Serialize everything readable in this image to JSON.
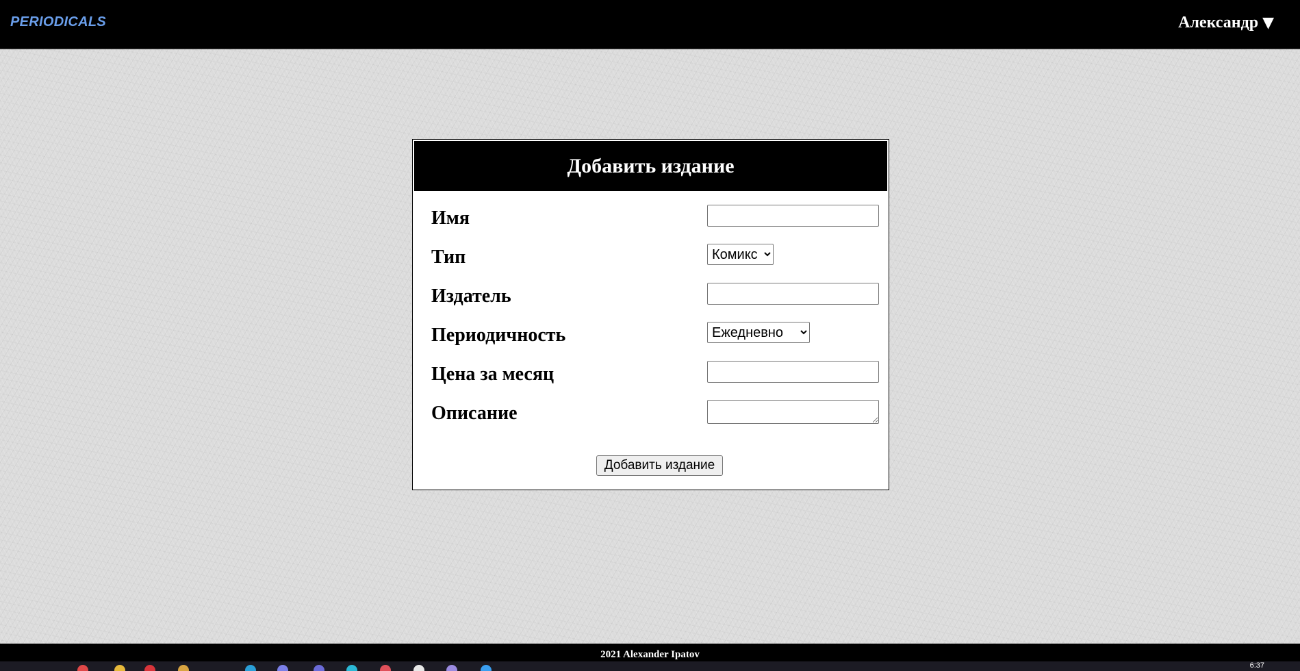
{
  "header": {
    "logo": "PERIODICALS",
    "user_name": "Александр",
    "user_caret": "▼"
  },
  "form": {
    "title": "Добавить издание",
    "fields": {
      "name": {
        "label": "Имя",
        "value": ""
      },
      "type": {
        "label": "Тип",
        "selected": "Комикс"
      },
      "publisher": {
        "label": "Издатель",
        "value": ""
      },
      "periodicity": {
        "label": "Периодичность",
        "selected": "Ежедневно"
      },
      "price": {
        "label": "Цена за месяц",
        "value": ""
      },
      "description": {
        "label": "Описание",
        "value": ""
      }
    },
    "submit_label": "Добавить издание"
  },
  "footer": {
    "text": "2021 Alexander Ipatov"
  },
  "taskbar": {
    "clock": "6:37",
    "icon_colors": [
      "#e04848",
      "#e6b83a",
      "#d8343a",
      "#d9a441",
      "#2a9fd8",
      "#7b7fe8",
      "#6b6bd8",
      "#2bb8d6",
      "#e0505a",
      "#e8e8e8",
      "#9a8ae0",
      "#3a9ef0"
    ]
  },
  "colors": {
    "logo": "#6a9eea",
    "header_bg": "#000000",
    "card_bg": "#ffffff"
  }
}
